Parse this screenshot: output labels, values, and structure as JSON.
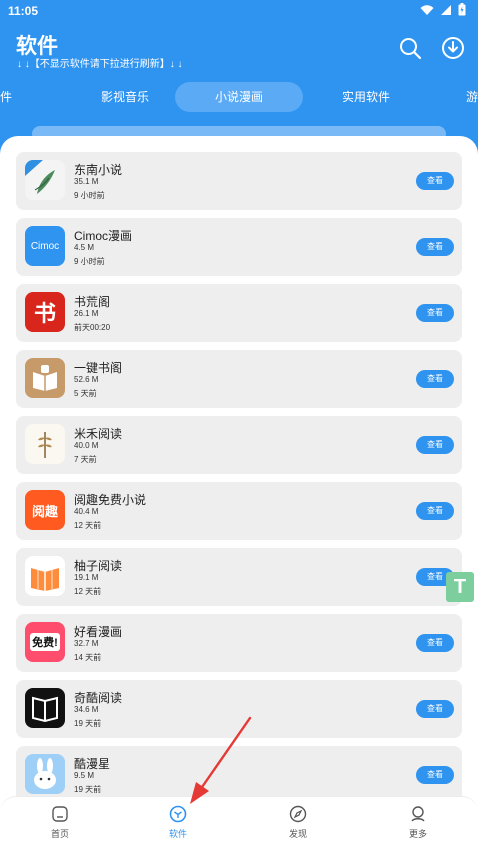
{
  "status": {
    "time": "11:05"
  },
  "header": {
    "title": "软件",
    "subtitle": "↓ ↓【不显示软件请下拉进行刷新】↓ ↓"
  },
  "tabs": [
    {
      "label": "件"
    },
    {
      "label": "影视音乐"
    },
    {
      "label": "小说漫画"
    },
    {
      "label": "实用软件"
    },
    {
      "label": "游"
    }
  ],
  "apps": [
    {
      "name": "东南小说",
      "size": "35.1 M",
      "time": "9 小时前",
      "button": "查看",
      "icon": "leaf-book-icon"
    },
    {
      "name": "Cimoc漫画",
      "size": "4.5 M",
      "time": "9 小时前",
      "button": "查看",
      "icon": "cimoc-icon",
      "icon_text": "Cimoc"
    },
    {
      "name": "书荒阁",
      "size": "26.1 M",
      "time": "前天00:20",
      "button": "查看",
      "icon": "shu-icon",
      "icon_text": "书"
    },
    {
      "name": "一键书阁",
      "size": "52.6 M",
      "time": "5 天前",
      "button": "查看",
      "icon": "open-book-icon"
    },
    {
      "name": "米禾阅读",
      "size": "40.0 M",
      "time": "7 天前",
      "button": "查看",
      "icon": "wheat-icon"
    },
    {
      "name": "阅趣免费小说",
      "size": "40.4 M",
      "time": "12 天前",
      "button": "查看",
      "icon": "yueqi-icon",
      "icon_text": "阅趣"
    },
    {
      "name": "柚子阅读",
      "size": "19.1 M",
      "time": "12 天前",
      "button": "查看",
      "icon": "orange-book-icon"
    },
    {
      "name": "好看漫画",
      "size": "32.7 M",
      "time": "14 天前",
      "button": "查看",
      "icon": "free-comic-icon",
      "icon_text": "免费!"
    },
    {
      "name": "奇酷阅读",
      "size": "34.6 M",
      "time": "19 天前",
      "button": "查看",
      "icon": "black-book-icon"
    },
    {
      "name": "酷漫星",
      "size": "9.5 M",
      "time": "19 天前",
      "button": "查看",
      "icon": "bunny-icon"
    }
  ],
  "float_badge": "T",
  "bottom_nav": [
    {
      "label": "首页",
      "icon": "home-icon"
    },
    {
      "label": "软件",
      "icon": "software-icon"
    },
    {
      "label": "发现",
      "icon": "compass-icon"
    },
    {
      "label": "更多",
      "icon": "user-icon"
    }
  ],
  "colors": {
    "accent": "#2f93f0",
    "annotation": "#e53935"
  }
}
